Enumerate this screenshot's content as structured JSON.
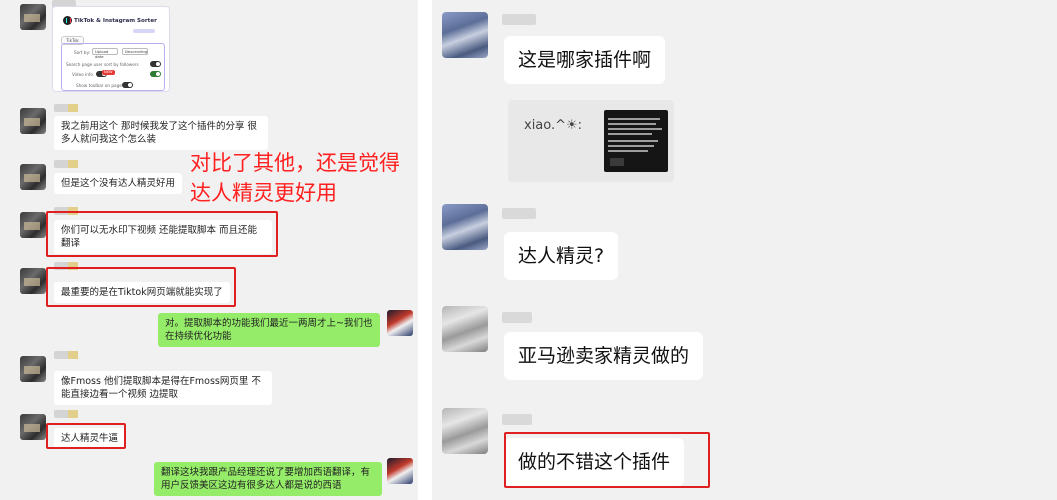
{
  "left": {
    "plugin": {
      "title": "TikTok & Instagram Sorter",
      "tab": "TikTok",
      "sort_label": "Sort by:",
      "sort_value": "Upload date",
      "order_value": "Descending",
      "search_label": "Search page user sort by followers",
      "video_info_label": "Video info",
      "hide_label": "Show toolbar on page"
    },
    "messages": [
      {
        "text": "我之前用这个 那时候我发了这个插件的分享 很多人就问我这个怎么装"
      },
      {
        "text": "但是这个没有达人精灵好用"
      },
      {
        "text": "你们可以无水印下视频 还能提取脚本 而且还能翻译"
      },
      {
        "text": "最重要的是在Tiktok网页端就能实现了"
      },
      {
        "text": "对。提取脚本的功能我们最近一两周才上~我们也在持续优化功能"
      },
      {
        "text": "像Fmoss 他们提取脚本是得在Fmoss网页里 不能直接边看一个视频 边提取"
      },
      {
        "text": "达人精灵牛逼"
      },
      {
        "text": "翻译这块我跟产品经理还说了要增加西语翻译，有用户反馈美区这边有很多达人都是说的西语"
      }
    ],
    "annotation": "对比了其他，还是觉得达人精灵更好用"
  },
  "right": {
    "messages": [
      {
        "text": "这是哪家插件啊"
      },
      {
        "text": "达人精灵?"
      },
      {
        "text": "亚马逊卖家精灵做的"
      },
      {
        "text": "做的不错这个插件"
      }
    ],
    "embed_text": "xiao.^☀:"
  },
  "colors": {
    "chat_bg": "#f1f1f1",
    "bubble_self": "#95ec69",
    "bubble_other": "#ffffff",
    "highlight": "#e02020"
  }
}
